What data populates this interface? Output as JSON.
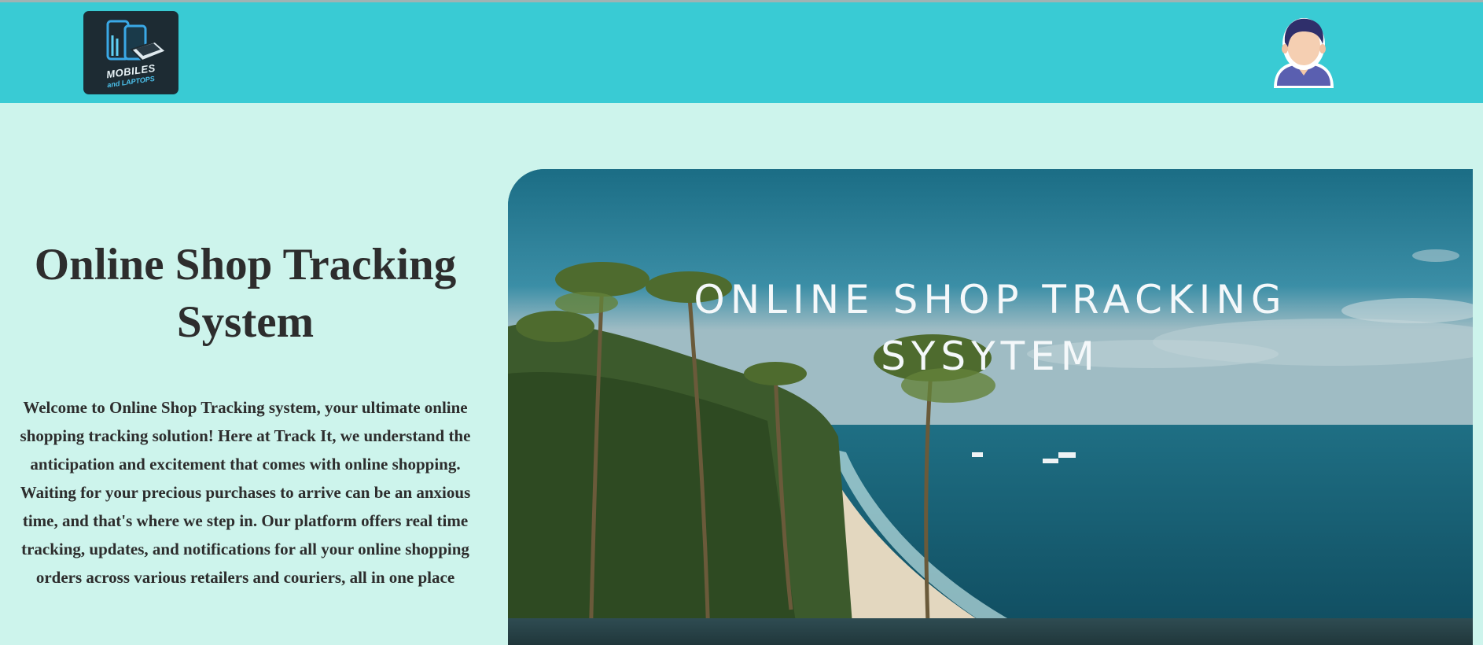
{
  "header": {
    "logo": {
      "icon": "mobiles-laptops-logo-icon",
      "line1": "MOBILES",
      "line2": "and LAPTOPS"
    },
    "profile": {
      "icon": "user-avatar-icon"
    },
    "colors": {
      "background": "#39cbd4"
    }
  },
  "main": {
    "title": "Online Shop Tracking System",
    "description": "Welcome to Online Shop Tracking system, your ultimate online shopping tracking solution! Here at Track It, we understand the anticipation and excitement that comes with online shopping. Waiting for your precious purchases to arrive can be an anxious time, and that's where we step in. Our platform offers real time tracking, updates, and notifications for all your online shopping orders across various retailers and couriers, all in one place"
  },
  "hero": {
    "title_line1": "ONLINE SHOP TRACKING",
    "title_line2": "SYSYTEM",
    "scene": "aerial-beach-palm-trees"
  },
  "colors": {
    "page_background": "#cdf4ec",
    "header_background": "#39cbd4",
    "text": "#2d2d2d"
  }
}
